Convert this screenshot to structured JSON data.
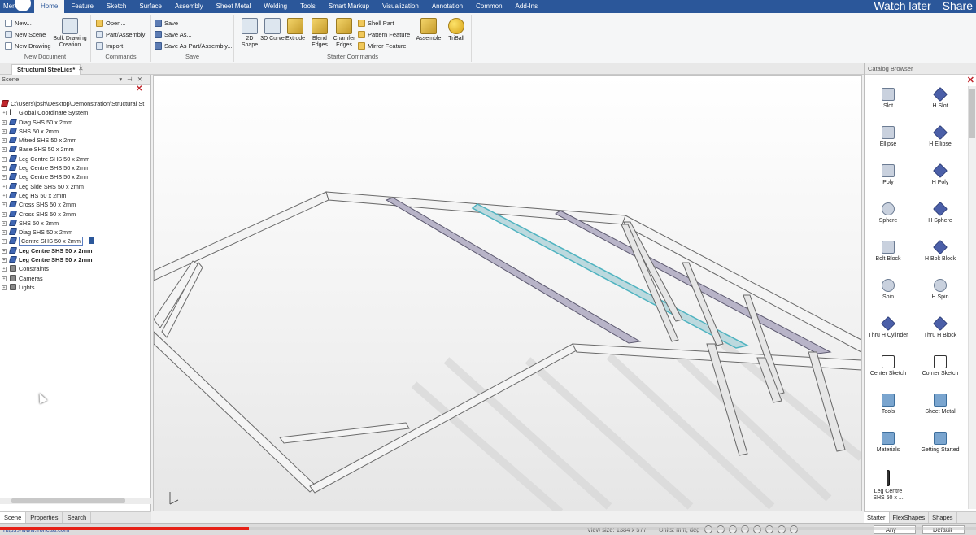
{
  "menubar": {
    "app_button": "Menu",
    "tabs": [
      "Home",
      "Feature",
      "Sketch",
      "Surface",
      "Assembly",
      "Sheet Metal",
      "Welding",
      "Tools",
      "Smart Markup",
      "Visualization",
      "Annotation",
      "Common",
      "Add-Ins"
    ],
    "active_tab": "Home",
    "watch_later": "Watch later",
    "share": "Share"
  },
  "ribbon": {
    "new_document": {
      "name": "New Document",
      "new": "New...",
      "new_scene": "New Scene",
      "new_drawing": "New Drawing",
      "bulk_drawing": "Bulk Drawing Creation"
    },
    "commands": {
      "name": "Commands",
      "open": "Open...",
      "part_assembly": "Part/Assembly",
      "import": "Import"
    },
    "save": {
      "name": "Save",
      "save": "Save",
      "save_as": "Save As...",
      "save_as_part": "Save As Part/Assembly..."
    },
    "starter": {
      "name": "Starter Commands",
      "shape_2d": "2D Shape",
      "curve_3d": "3D Curve",
      "extrude": "Extrude",
      "blend_edges": "Blend Edges",
      "chamfer_edges": "Chamfer Edges",
      "shell_part": "Shell Part",
      "pattern_feature": "Pattern Feature",
      "mirror_feature": "Mirror Feature",
      "assemble": "Assemble",
      "triball": "TriBall"
    }
  },
  "document_tab": "Structural SteeLics*",
  "scene": {
    "title": "Scene",
    "root": "C:\\Users\\josh\\Desktop\\Demonstration\\Structural St",
    "items": [
      {
        "label": "Global Coordinate System",
        "icon": "axes-icon"
      },
      {
        "label": "Diag SHS 50 x 2mm",
        "icon": "part-icon"
      },
      {
        "label": "SHS 50 x 2mm",
        "icon": "part-icon"
      },
      {
        "label": "Mitred SHS 50 x 2mm",
        "icon": "part-icon"
      },
      {
        "label": "Base SHS 50 x 2mm",
        "icon": "part-icon"
      },
      {
        "label": "Leg Centre SHS 50 x 2mm",
        "icon": "part-icon"
      },
      {
        "label": "Leg Centre SHS 50 x 2mm",
        "icon": "part-icon"
      },
      {
        "label": "Leg Centre SHS 50 x 2mm",
        "icon": "part-icon"
      },
      {
        "label": "Leg Side SHS 50 x 2mm",
        "icon": "part-icon"
      },
      {
        "label": "Leg HS 50 x 2mm",
        "icon": "part-icon"
      },
      {
        "label": "Cross SHS 50 x 2mm",
        "icon": "part-icon"
      },
      {
        "label": "Cross SHS 50 x 2mm",
        "icon": "part-icon"
      },
      {
        "label": "SHS 50 x 2mm",
        "icon": "part-icon"
      },
      {
        "label": "Diag SHS 50 x 2mm",
        "icon": "part-icon"
      },
      {
        "label": "Centre SHS 50 x 2mm",
        "icon": "part-icon"
      },
      {
        "label": "Leg Centre SHS 50 x 2mm",
        "icon": "part-icon"
      },
      {
        "label": "Leg Centre SHS 50 x 2mm",
        "icon": "part-icon"
      },
      {
        "label": "Constraints",
        "icon": "constraints-icon"
      },
      {
        "label": "Cameras",
        "icon": "camera-icon"
      },
      {
        "label": "Lights",
        "icon": "light-icon"
      }
    ],
    "selected_index": 14,
    "bold_indices": [
      15,
      16
    ]
  },
  "catalog": {
    "title": "Catalog Browser",
    "items": [
      {
        "label": "Slot",
        "kind": "solid"
      },
      {
        "label": "H Slot",
        "kind": "h"
      },
      {
        "label": "Ellipse",
        "kind": "solid"
      },
      {
        "label": "H Ellipse",
        "kind": "h"
      },
      {
        "label": "Poly",
        "kind": "solid"
      },
      {
        "label": "H Poly",
        "kind": "h"
      },
      {
        "label": "Sphere",
        "kind": "round"
      },
      {
        "label": "H Sphere",
        "kind": "h"
      },
      {
        "label": "Bolt Block",
        "kind": "solid"
      },
      {
        "label": "H Bolt Block",
        "kind": "h"
      },
      {
        "label": "Spin",
        "kind": "round"
      },
      {
        "label": "H Spin",
        "kind": "round"
      },
      {
        "label": "Thru H Cylinder",
        "kind": "h"
      },
      {
        "label": "Thru H Block",
        "kind": "h"
      },
      {
        "label": "Center Sketch",
        "kind": "sketch"
      },
      {
        "label": "Corner Sketch",
        "kind": "sketch"
      },
      {
        "label": "Tools",
        "kind": "folder"
      },
      {
        "label": "Sheet Metal",
        "kind": "folder"
      },
      {
        "label": "Materials",
        "kind": "folder"
      },
      {
        "label": "Getting Started",
        "kind": "folder"
      },
      {
        "label": "Leg Centre SHS 50 x ...",
        "kind": "bar"
      }
    ],
    "tabs": [
      "Starter",
      "FlexShapes",
      "Shapes"
    ]
  },
  "bottom_tabs": [
    "Scene",
    "Properties",
    "Search"
  ],
  "status": {
    "url": "https://www.ironcad.com",
    "view_size": "View size: 1384 x 577",
    "units": "Units: mm, deg",
    "filter": "Any",
    "mode": "Default"
  },
  "video": {
    "progress": 0.255
  }
}
